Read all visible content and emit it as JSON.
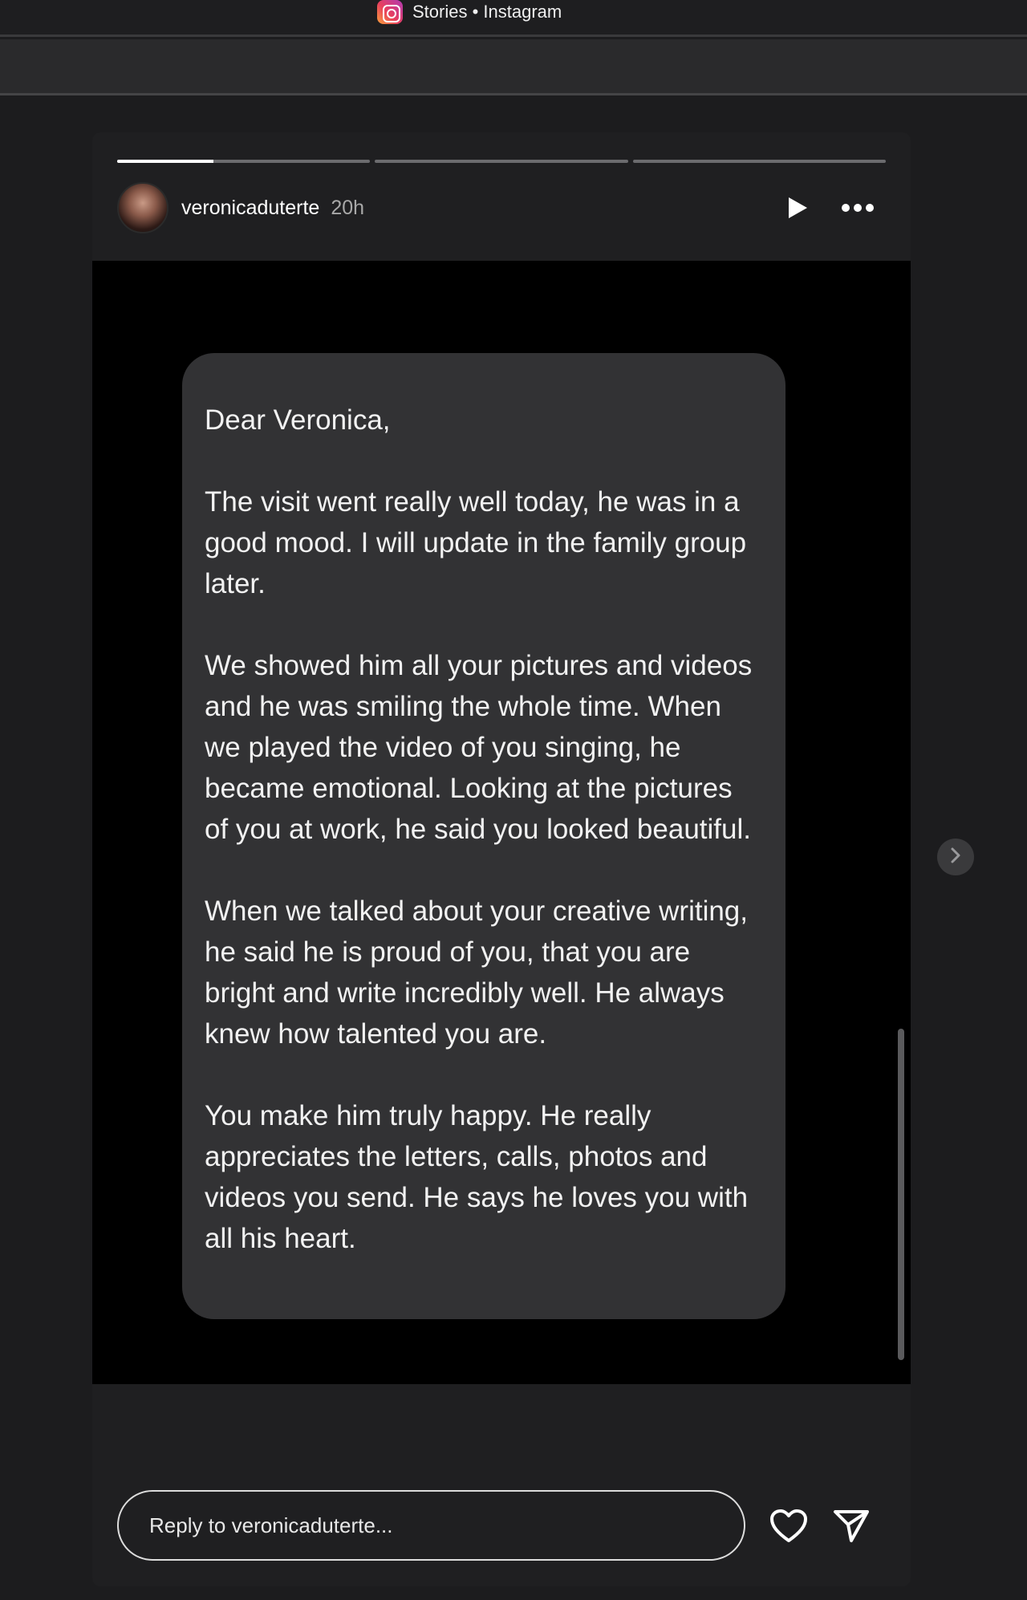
{
  "window": {
    "title": "Stories • Instagram",
    "icon": "instagram-icon"
  },
  "story": {
    "progress": [
      0.38,
      0.0,
      0.0
    ],
    "username": "veronicaduterte",
    "time_ago": "20h",
    "note": {
      "paragraphs": [
        "Dear Veronica,",
        "The visit went really well today, he was in a good mood. I will update in the family group later.",
        "We showed him all your pictures and videos and he was smiling the whole time. When we played the video of you singing, he became emotional. Looking at the pictures of you at work, he said you looked beautiful.",
        "When we talked about your creative writing, he said he is proud of you, that you are bright and write incredibly well. He always knew how talented you are.",
        "You make him truly happy. He really appreciates the letters, calls, photos and videos you send. He says he loves you with all his heart."
      ]
    }
  },
  "reply": {
    "placeholder": "Reply to veronicaduterte...",
    "value": ""
  },
  "icons": [
    "instagram-icon",
    "play-icon",
    "more-icon",
    "chevron-right-icon",
    "heart-icon",
    "send-icon"
  ],
  "colors": {
    "background": "#1c1c1e",
    "story_bg": "#000000",
    "card_bg": "#323234",
    "text": "#f2f2f2"
  }
}
